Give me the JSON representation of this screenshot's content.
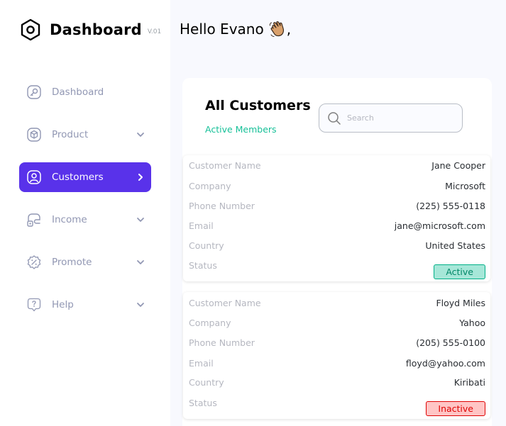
{
  "brand": {
    "title": "Dashboard",
    "version": "V.01"
  },
  "greeting": "Hello Evano",
  "greeting_suffix": ",",
  "nav": {
    "items": [
      {
        "label": "Dashboard",
        "icon": "key-icon",
        "has_chevron": false,
        "active": false
      },
      {
        "label": "Product",
        "icon": "cube-icon",
        "has_chevron": true,
        "active": false
      },
      {
        "label": "Customers",
        "icon": "user-square-icon",
        "has_chevron": true,
        "active": true
      },
      {
        "label": "Income",
        "icon": "wallet-icon",
        "has_chevron": true,
        "active": false
      },
      {
        "label": "Promote",
        "icon": "discount-badge-icon",
        "has_chevron": true,
        "active": false
      },
      {
        "label": "Help",
        "icon": "help-message-icon",
        "has_chevron": true,
        "active": false
      }
    ]
  },
  "panel": {
    "title": "All Customers",
    "subtitle": "Active Members",
    "search": {
      "placeholder": "Search",
      "value": ""
    }
  },
  "fields": {
    "name": "Customer Name",
    "company": "Company",
    "phone": "Phone Number",
    "email": "Email",
    "country": "Country",
    "status": "Status"
  },
  "customers": [
    {
      "name": "Jane Cooper",
      "company": "Microsoft",
      "phone": "(225) 555-0118",
      "email": "jane@microsoft.com",
      "country": "United States",
      "status": "Active"
    },
    {
      "name": "Floyd Miles",
      "company": "Yahoo",
      "phone": "(205) 555-0100",
      "email": "floyd@yahoo.com",
      "country": "Kiribati",
      "status": "Inactive"
    }
  ],
  "colors": {
    "accent": "#5932ea",
    "nav_text": "#9197b3",
    "subtitle": "#16c098",
    "active_bg": "#a6e7d8",
    "active_text": "#008767",
    "inactive_bg": "#ffc5c5",
    "inactive_text": "#df0404"
  }
}
